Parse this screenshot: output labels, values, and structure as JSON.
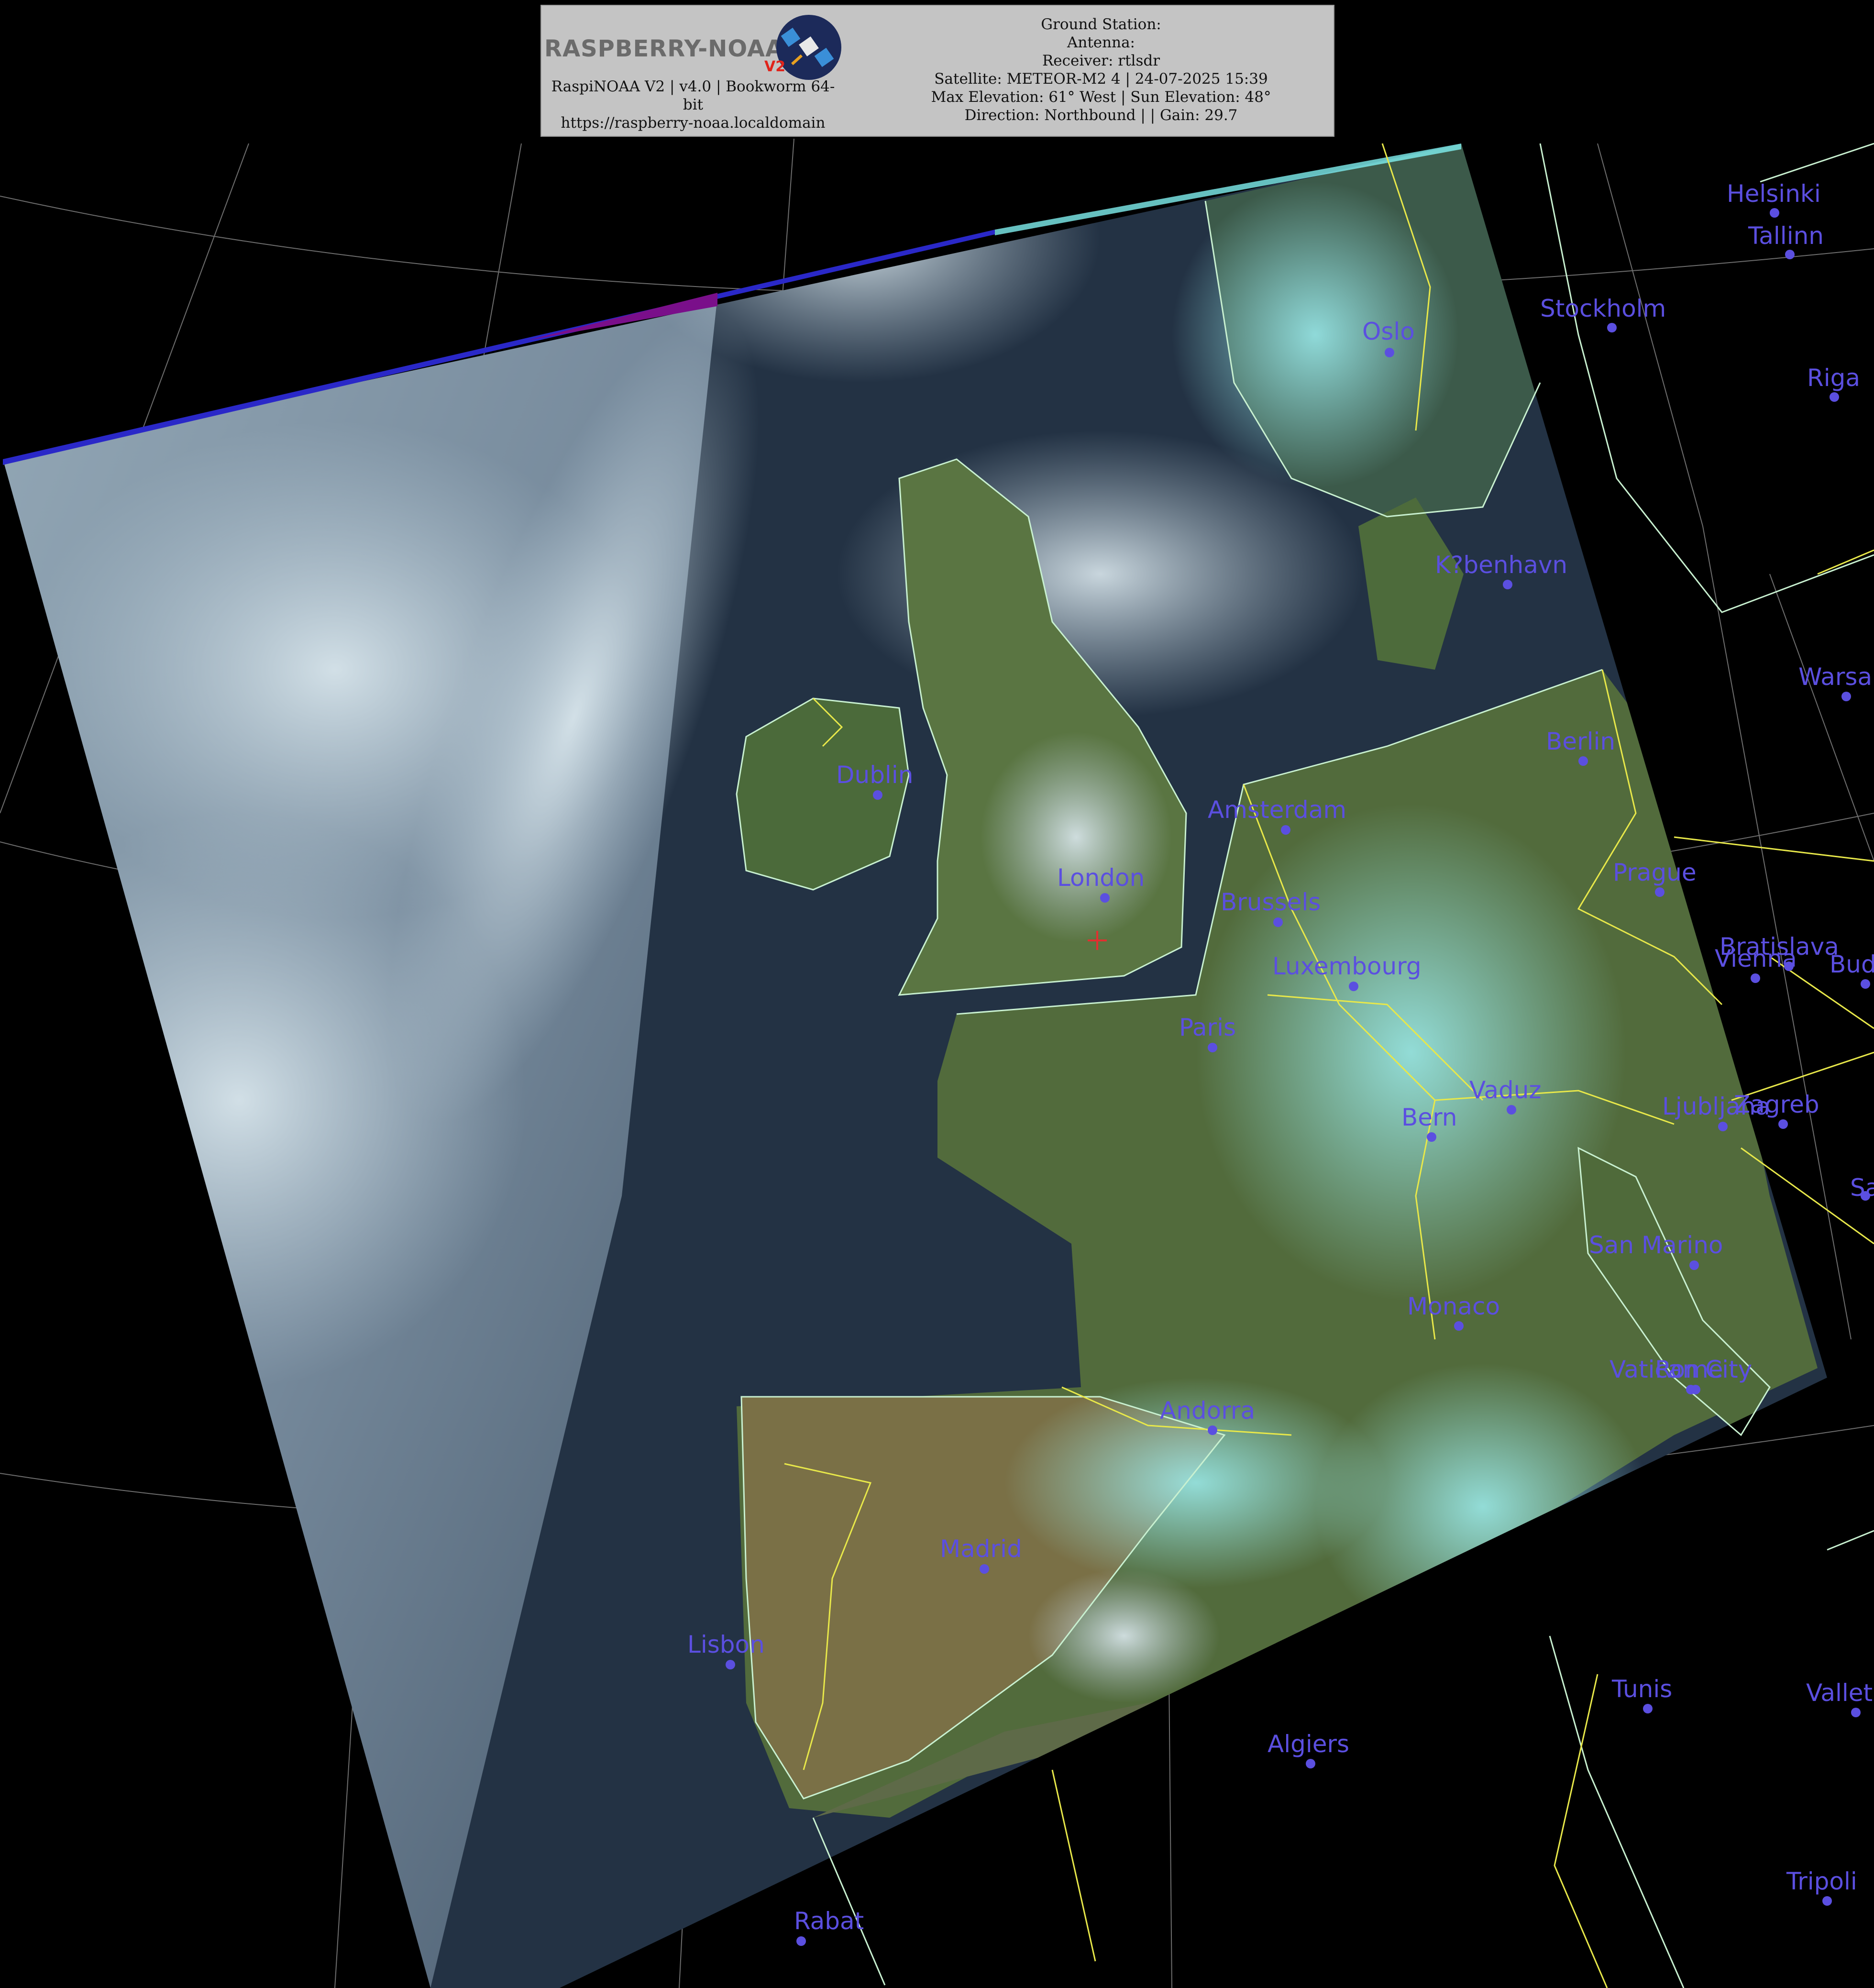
{
  "header": {
    "logo": {
      "text": "RASPBERRY-NOAA",
      "version_mark": "V2",
      "badge_icon": "satellite-icon"
    },
    "left_lines": [
      "RaspiNOAA V2 | v4.0 | Bookworm 64-",
      "bit",
      "https://raspberry-noaa.localdomain"
    ],
    "right_lines": [
      "Ground Station:",
      "Antenna:",
      "Receiver: rtlsdr",
      "Satellite: METEOR-M2 4 | 24-07-2025 15:39",
      "Max Elevation: 61° West | Sun Elevation: 48°",
      "Direction: Northbound | | Gain: 29.7"
    ]
  },
  "map": {
    "cities": [
      {
        "name": "Helsinki"
      },
      {
        "name": "Tallinn"
      },
      {
        "name": "Stockholm"
      },
      {
        "name": "Oslo"
      },
      {
        "name": "Riga"
      },
      {
        "name": "K?benhavn"
      },
      {
        "name": "Warsa"
      },
      {
        "name": "Berlin"
      },
      {
        "name": "Dublin"
      },
      {
        "name": "Amsterdam"
      },
      {
        "name": "London"
      },
      {
        "name": "Brussels"
      },
      {
        "name": "Prague"
      },
      {
        "name": "Luxembourg"
      },
      {
        "name": "Bratislava"
      },
      {
        "name": "Vienna"
      },
      {
        "name": "Buda"
      },
      {
        "name": "Paris"
      },
      {
        "name": "Vaduz"
      },
      {
        "name": "Bern"
      },
      {
        "name": "Ljubljana"
      },
      {
        "name": "Zagreb"
      },
      {
        "name": "Sa"
      },
      {
        "name": "San Marino"
      },
      {
        "name": "Monaco"
      },
      {
        "name": "Vatican City"
      },
      {
        "name": "Rome"
      },
      {
        "name": "Andorra"
      },
      {
        "name": "Madrid"
      },
      {
        "name": "Lisbon"
      },
      {
        "name": "Tunis"
      },
      {
        "name": "Vallet"
      },
      {
        "name": "Algiers"
      },
      {
        "name": "Tripoli"
      },
      {
        "name": "Rabat"
      }
    ],
    "ground_station_marker": "crosshair-icon",
    "colors": {
      "city_label": "#5b4fe0",
      "country_border": "#e8e84a",
      "coastline": "#c8f0d0",
      "graticule": "#8a8a8a",
      "marker": "#e03030",
      "background": "#000000"
    }
  }
}
